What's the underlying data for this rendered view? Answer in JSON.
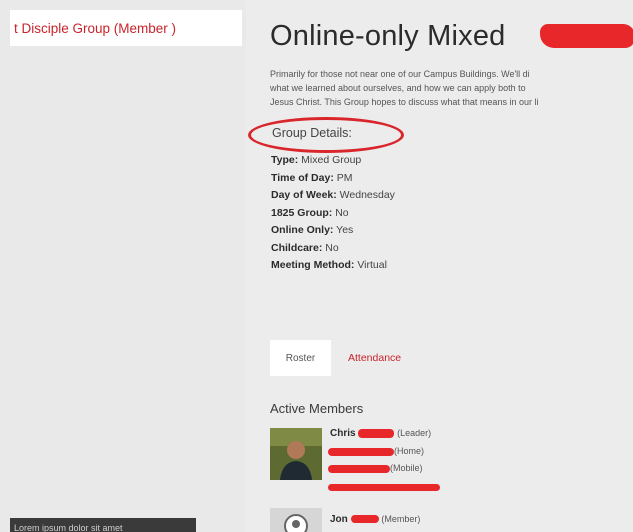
{
  "breadcrumb": {
    "text": "t Disciple Group (Member )"
  },
  "tooltip": {
    "text": "Lorem ipsum dolor sit amet"
  },
  "group": {
    "title": "Online-only Mixed",
    "description_lines": [
      "Primarily for those not near one of our Campus Buildings. We'll di",
      "what we learned about ourselves, and how we can apply both to",
      "Jesus Christ. This Group hopes to discuss what that means in our li"
    ]
  },
  "details": {
    "heading": "Group Details:",
    "items": [
      {
        "key": "Type:",
        "value": "Mixed Group"
      },
      {
        "key": "Time of Day:",
        "value": "PM"
      },
      {
        "key": "Day of Week:",
        "value": "Wednesday"
      },
      {
        "key": "1825 Group:",
        "value": "No"
      },
      {
        "key": "Online Only:",
        "value": "Yes"
      },
      {
        "key": "Childcare:",
        "value": "No"
      },
      {
        "key": "Meeting Method:",
        "value": "Virtual"
      }
    ]
  },
  "tabs": {
    "roster": "Roster",
    "attendance": "Attendance"
  },
  "members": {
    "heading": "Active Members",
    "list": [
      {
        "first_name": "Chris",
        "role": "(Leader)",
        "phone_home": "(Home)",
        "phone_mobile": "(Mobile)"
      },
      {
        "first_name": "Jon",
        "role": "(Member)"
      }
    ]
  },
  "colors": {
    "accent": "#c9242b",
    "redaction": "#e8272b",
    "background": "#ececec"
  }
}
